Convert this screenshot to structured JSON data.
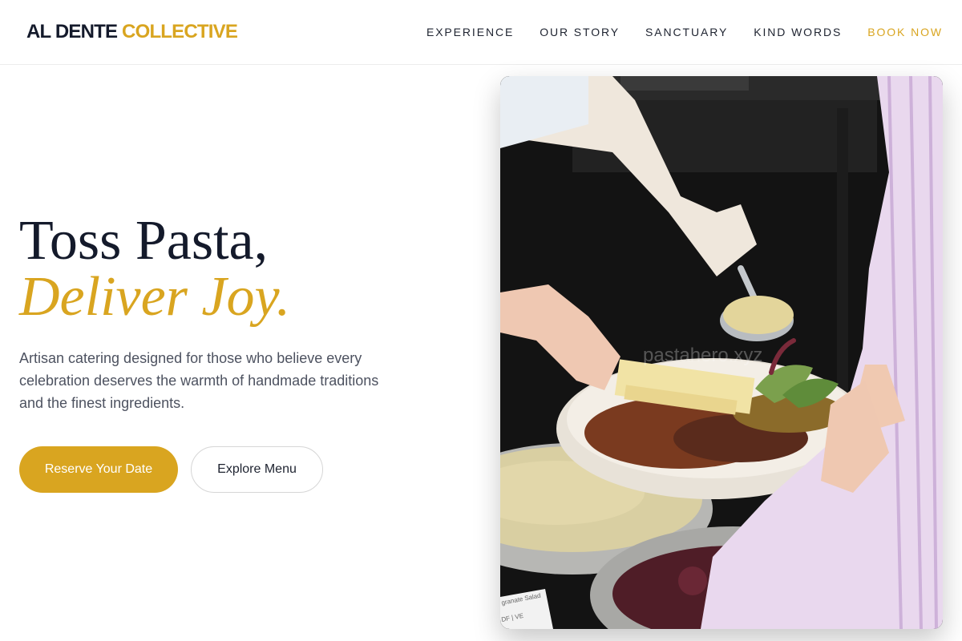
{
  "header": {
    "logo_primary": "AL DENTE",
    "logo_accent": "COLLECTIVE",
    "nav": [
      {
        "label": "EXPERIENCE"
      },
      {
        "label": "OUR STORY"
      },
      {
        "label": "SANCTUARY"
      },
      {
        "label": "KIND WORDS"
      },
      {
        "label": "BOOK NOW"
      }
    ]
  },
  "hero": {
    "title_line1": "Toss Pasta,",
    "title_line2": "Deliver Joy.",
    "subtitle": "Artisan catering designed for those who believe every celebration deserves the warmth of handmade traditions and the finest ingredients.",
    "primary_button": "Reserve Your Date",
    "secondary_button": "Explore Menu"
  },
  "image": {
    "watermark": "pastahero.xyz",
    "card_text_line1": "granate Salad",
    "card_text_line2": "DF | VE"
  },
  "colors": {
    "accent": "#d9a520",
    "heading": "#141a2b",
    "body_text": "#4d5260"
  }
}
